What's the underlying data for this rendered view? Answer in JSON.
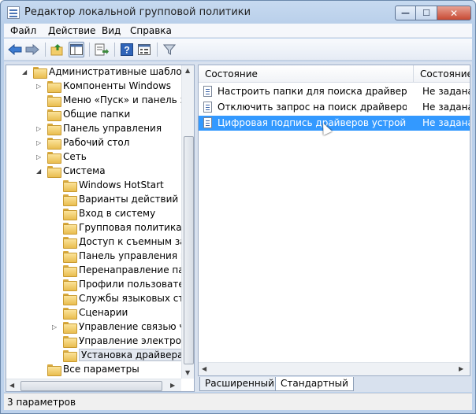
{
  "window": {
    "title": "Редактор локальной групповой политики"
  },
  "titlebar": {
    "min_glyph": "—",
    "max_glyph": "☐",
    "close_glyph": "✕"
  },
  "menubar": {
    "items": [
      "Файл",
      "Действие",
      "Вид",
      "Справка"
    ]
  },
  "toolbar": {
    "icons": [
      "back-arrow-icon",
      "forward-arrow-icon",
      "folder-up-icon",
      "show-hide-tree-icon",
      "export-list-icon",
      "help-icon",
      "properties-icon",
      "filter-icon"
    ]
  },
  "tree": {
    "items": [
      {
        "label": "Административные шаблоны",
        "level": 0,
        "expander": "collapse",
        "icon": "folder"
      },
      {
        "label": "Компоненты Windows",
        "level": 1,
        "expander": "expand",
        "icon": "folder"
      },
      {
        "label": "Меню «Пуск» и панель задач",
        "level": 1,
        "expander": "none",
        "icon": "folder"
      },
      {
        "label": "Общие папки",
        "level": 1,
        "expander": "none",
        "icon": "folder"
      },
      {
        "label": "Панель управления",
        "level": 1,
        "expander": "expand",
        "icon": "folder"
      },
      {
        "label": "Рабочий стол",
        "level": 1,
        "expander": "expand",
        "icon": "folder"
      },
      {
        "label": "Сеть",
        "level": 1,
        "expander": "expand",
        "icon": "folder"
      },
      {
        "label": "Система",
        "level": 1,
        "expander": "collapse",
        "icon": "folder"
      },
      {
        "label": "Windows HotStart",
        "level": 2,
        "expander": "none",
        "icon": "folder"
      },
      {
        "label": "Варианты действий после нажатия CTRL+ALT+DEL",
        "level": 2,
        "expander": "none",
        "icon": "folder"
      },
      {
        "label": "Вход в систему",
        "level": 2,
        "expander": "none",
        "icon": "folder"
      },
      {
        "label": "Групповая политика",
        "level": 2,
        "expander": "none",
        "icon": "folder"
      },
      {
        "label": "Доступ к съемным запоминающим устройствам",
        "level": 2,
        "expander": "none",
        "icon": "folder"
      },
      {
        "label": "Панель управления просмотром",
        "level": 2,
        "expander": "none",
        "icon": "folder"
      },
      {
        "label": "Перенаправление папок",
        "level": 2,
        "expander": "none",
        "icon": "folder"
      },
      {
        "label": "Профили пользователей",
        "level": 2,
        "expander": "none",
        "icon": "folder"
      },
      {
        "label": "Службы языковых стандартов",
        "level": 2,
        "expander": "none",
        "icon": "folder"
      },
      {
        "label": "Сценарии",
        "level": 2,
        "expander": "none",
        "icon": "folder"
      },
      {
        "label": "Управление связью через Интернет",
        "level": 2,
        "expander": "expand",
        "icon": "folder"
      },
      {
        "label": "Управление электропитанием",
        "level": 2,
        "expander": "none",
        "icon": "folder"
      },
      {
        "label": "Установка драйвера",
        "level": 2,
        "expander": "none",
        "icon": "folder",
        "selected": true
      },
      {
        "label": "Все параметры",
        "level": 1,
        "expander": "none",
        "icon": "all-settings"
      }
    ]
  },
  "list": {
    "columns": [
      "Состояние",
      "Состояние"
    ],
    "rows": [
      {
        "name": "Настроить папки для поиска драйверов",
        "state": "Не задана"
      },
      {
        "name": "Отключить запрос на поиск драйверов у...",
        "state": "Не задана"
      },
      {
        "name": "Цифровая подпись драйверов устройств",
        "state": "Не задана",
        "selected": true
      }
    ]
  },
  "tabs": {
    "extended": "Расширенный",
    "standard": "Стандартный"
  },
  "status": {
    "text": "3 параметров"
  },
  "scroll_glyphs": {
    "up": "▲",
    "down": "▼",
    "left": "◀",
    "right": "▶"
  }
}
